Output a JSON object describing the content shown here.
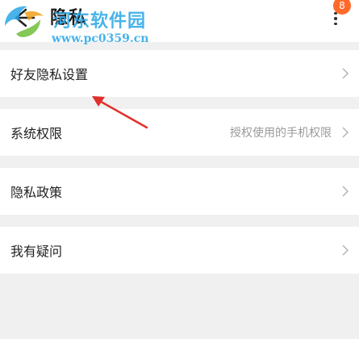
{
  "header": {
    "title": "隐私",
    "badge_count": "8",
    "back_icon": "back-arrow-icon",
    "more_icon": "more-vertical-icon"
  },
  "watermark": {
    "cn_text": "河东软件园",
    "url": "www.pc0359.cn",
    "color": "#29a6e6"
  },
  "menu": {
    "items": [
      {
        "label": "好友隐私设置",
        "detail": ""
      },
      {
        "label": "系统权限",
        "detail": "授权使用的手机权限"
      },
      {
        "label": "隐私政策",
        "detail": ""
      },
      {
        "label": "我有疑问",
        "detail": ""
      }
    ]
  },
  "colors": {
    "background": "#f0f0f0",
    "row": "#ffffff",
    "badge": "#ff6a2a",
    "annotation_arrow": "#e0302c"
  }
}
